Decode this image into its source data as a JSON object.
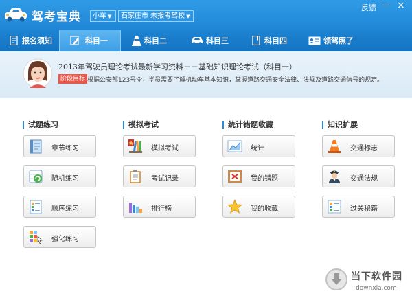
{
  "app": {
    "title": "驾考宝典",
    "car_type": "小车",
    "city_school": "石家庄市 未报考驾校",
    "feedback": "反馈",
    "minimize_glyph": "—",
    "close_glyph": "×"
  },
  "tabs": [
    {
      "label": "报名须知",
      "icon": "document-icon",
      "active": false
    },
    {
      "label": "科目一",
      "icon": "pencil-icon",
      "active": true
    },
    {
      "label": "科目二",
      "icon": "traffic-cone-icon",
      "active": false
    },
    {
      "label": "科目三",
      "icon": "car-icon",
      "active": false
    },
    {
      "label": "科目四",
      "icon": "book-icon",
      "active": false
    },
    {
      "label": "领驾照了",
      "icon": "license-card-icon",
      "active": false
    }
  ],
  "banner": {
    "title": "2013年驾驶员理论考试最新学习资料－－基础知识理论考试（科目一）",
    "badge": "阶段目标",
    "description": "根据公安部123号令，学员需要了解机动车基本知识，掌握道路交通安全法律、法规及道路交通信号的规定。"
  },
  "sections": [
    {
      "title": "试题练习",
      "buttons": [
        {
          "label": "章节练习",
          "icon": "chapter-book-icon"
        },
        {
          "label": "随机练习",
          "icon": "random-refresh-icon"
        },
        {
          "label": "顺序练习",
          "icon": "sequence-list-icon"
        },
        {
          "label": "强化练习",
          "icon": "strengthen-blocks-icon"
        }
      ]
    },
    {
      "title": "模拟考试",
      "buttons": [
        {
          "label": "模拟考试",
          "icon": "exam-pencils-icon"
        },
        {
          "label": "考试记录",
          "icon": "clipboard-icon"
        },
        {
          "label": "排行榜",
          "icon": "bar-ranking-icon"
        }
      ]
    },
    {
      "title": "统计错题收藏",
      "buttons": [
        {
          "label": "统计",
          "icon": "statistics-chart-icon"
        },
        {
          "label": "我的错题",
          "icon": "wrong-answer-icon"
        },
        {
          "label": "我的收藏",
          "icon": "star-icon"
        }
      ]
    },
    {
      "title": "知识扩展",
      "buttons": [
        {
          "label": "交通标志",
          "icon": "traffic-cone-icon"
        },
        {
          "label": "交通法规",
          "icon": "police-officer-icon"
        },
        {
          "label": "过关秘籍",
          "icon": "secret-tips-icon"
        }
      ]
    }
  ],
  "watermark": {
    "text": "当下软件园",
    "domain": "downxia.com"
  },
  "colors": {
    "titlebar": "#1f86d6",
    "tabbar": "#1574c2",
    "accent": "#2b8ad6",
    "badge": "#e8584b"
  }
}
